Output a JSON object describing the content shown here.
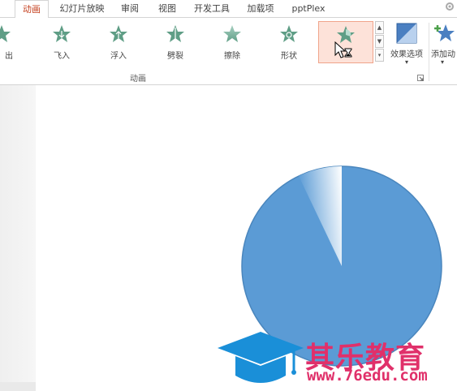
{
  "tabs": [
    {
      "label": "动画",
      "active": true
    },
    {
      "label": "幻灯片放映"
    },
    {
      "label": "审阅"
    },
    {
      "label": "视图"
    },
    {
      "label": "开发工具"
    },
    {
      "label": "加载项"
    },
    {
      "label": "pptPlex"
    }
  ],
  "gallery": [
    {
      "label": "出",
      "icon": "star-partial-icon"
    },
    {
      "label": "飞入",
      "icon": "star-fly-in-icon"
    },
    {
      "label": "浮入",
      "icon": "star-float-in-icon"
    },
    {
      "label": "劈裂",
      "icon": "star-split-icon"
    },
    {
      "label": "擦除",
      "icon": "star-wipe-icon"
    },
    {
      "label": "形状",
      "icon": "star-shape-icon"
    },
    {
      "label": "",
      "icon": "star-wheel-icon",
      "selected": true
    }
  ],
  "effect_options": {
    "label": "效果选项",
    "arrow": "▾"
  },
  "add_animation": {
    "label": "添加动",
    "arrow": "▾"
  },
  "group_label": "动画",
  "scroll": {
    "up": "▲",
    "down": "▼",
    "more": "▾"
  },
  "watermark": {
    "title": "其乐教育",
    "url": "www.76edu.com"
  },
  "colors": {
    "active_tab": "#c43e1c",
    "star": "#5f9e86",
    "selected_bg": "#fde2d9",
    "pie": "#5b9bd5",
    "watermark": "#e0306a",
    "cap": "#1a8fd8"
  }
}
